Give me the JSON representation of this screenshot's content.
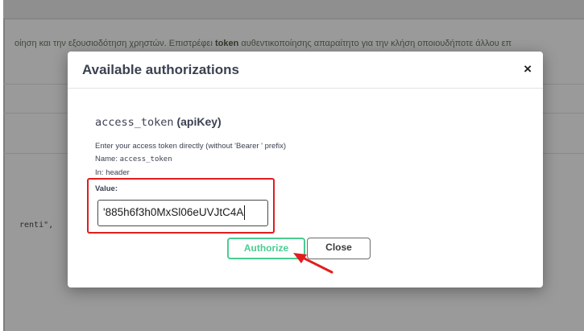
{
  "background": {
    "description_prefix": "οίηση και την εξουσιοδότηση χρηστών. Επιστρέφει ",
    "description_bold": "token",
    "description_suffix": " αυθεντικοποίησης απαραίτητο για την κλήση οποιουδήποτε άλλου επ",
    "code_snippet": "renti\","
  },
  "modal": {
    "title": "Available authorizations",
    "close_symbol": "×",
    "scheme_name": "access_token",
    "scheme_type": "(apiKey)",
    "description": "Enter your access token directly (without 'Bearer ' prefix)",
    "name_label": "Name:",
    "name_value": "access_token",
    "in_label": "In:",
    "in_value": "header",
    "value_label": "Value:",
    "value_input": "'885h6f3h0MxSl06eUVJtC4A",
    "authorize_label": "Authorize",
    "close_label": "Close"
  },
  "colors": {
    "annotation_red": "#e11d1d",
    "authorize_green": "#49cc90",
    "overlay_gray": "#9a9a9a"
  }
}
